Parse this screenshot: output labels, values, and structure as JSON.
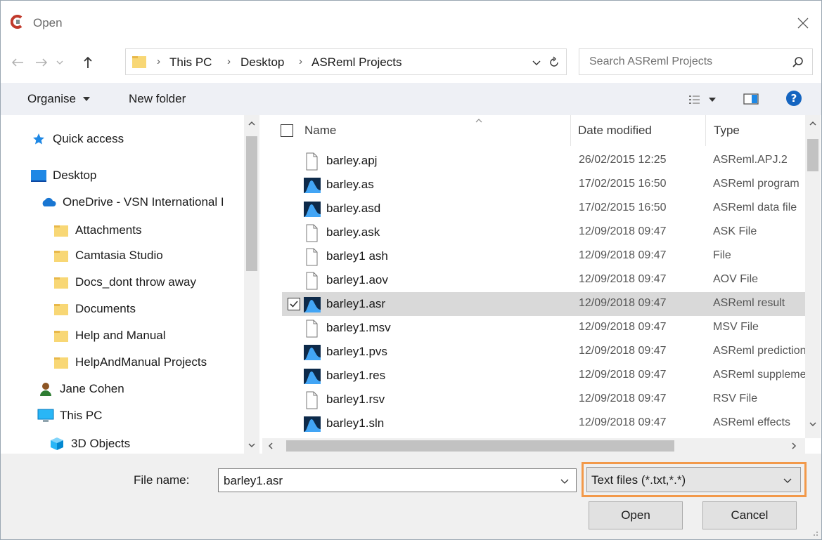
{
  "window": {
    "title": "Open"
  },
  "address": {
    "crumbs": [
      "This PC",
      "Desktop",
      "ASReml Projects"
    ],
    "search_placeholder": "Search ASReml Projects"
  },
  "toolbar": {
    "organise_label": "Organise",
    "new_folder_label": "New folder"
  },
  "nav": {
    "items": [
      {
        "label": "Quick access",
        "icon": "star-icon"
      },
      {
        "label": "Desktop",
        "icon": "desktop-icon"
      },
      {
        "label": "OneDrive - VSN International I",
        "icon": "cloud-icon"
      },
      {
        "label": "Attachments",
        "icon": "folder-icon"
      },
      {
        "label": "Camtasia Studio",
        "icon": "folder-icon"
      },
      {
        "label": "Docs_dont throw away",
        "icon": "folder-icon"
      },
      {
        "label": "Documents",
        "icon": "folder-icon"
      },
      {
        "label": "Help and Manual",
        "icon": "folder-icon"
      },
      {
        "label": "HelpAndManual Projects",
        "icon": "folder-icon"
      },
      {
        "label": "Jane Cohen",
        "icon": "user-icon"
      },
      {
        "label": "This PC",
        "icon": "computer-icon"
      },
      {
        "label": "3D Objects",
        "icon": "cube-icon"
      }
    ]
  },
  "columns": {
    "name": "Name",
    "date": "Date modified",
    "type": "Type"
  },
  "files": [
    {
      "name": "barley.apj",
      "date": "26/02/2015 12:25",
      "type": "ASReml.APJ.2",
      "icon": "document-icon",
      "selected": false
    },
    {
      "name": "barley.as",
      "date": "17/02/2015 16:50",
      "type": "ASReml program",
      "icon": "asreml-icon",
      "selected": false
    },
    {
      "name": "barley.asd",
      "date": "17/02/2015 16:50",
      "type": "ASReml data file",
      "icon": "asreml-icon",
      "selected": false
    },
    {
      "name": "barley.ask",
      "date": "12/09/2018 09:47",
      "type": "ASK File",
      "icon": "document-icon",
      "selected": false
    },
    {
      "name": "barley1 ash",
      "date": "12/09/2018 09:47",
      "type": "File",
      "icon": "document-icon",
      "selected": false
    },
    {
      "name": "barley1.aov",
      "date": "12/09/2018 09:47",
      "type": "AOV File",
      "icon": "document-icon",
      "selected": false
    },
    {
      "name": "barley1.asr",
      "date": "12/09/2018 09:47",
      "type": "ASReml result",
      "icon": "asreml-icon",
      "selected": true
    },
    {
      "name": "barley1.msv",
      "date": "12/09/2018 09:47",
      "type": "MSV File",
      "icon": "document-icon",
      "selected": false
    },
    {
      "name": "barley1.pvs",
      "date": "12/09/2018 09:47",
      "type": "ASReml predictions",
      "icon": "asreml-icon",
      "selected": false
    },
    {
      "name": "barley1.res",
      "date": "12/09/2018 09:47",
      "type": "ASReml supplementary",
      "icon": "asreml-icon",
      "selected": false
    },
    {
      "name": "barley1.rsv",
      "date": "12/09/2018 09:47",
      "type": "RSV File",
      "icon": "document-icon",
      "selected": false
    },
    {
      "name": "barley1.sln",
      "date": "12/09/2018 09:47",
      "type": "ASReml effects",
      "icon": "asreml-icon",
      "selected": false
    }
  ],
  "footer": {
    "file_name_label": "File name:",
    "file_name_value": "barley1.asr",
    "file_type_value": "Text files (*.txt,*.*)",
    "open_label": "Open",
    "cancel_label": "Cancel"
  },
  "colors": {
    "accent": "#f2994a",
    "selection": "#d9d9d9",
    "help": "#1565c0"
  }
}
